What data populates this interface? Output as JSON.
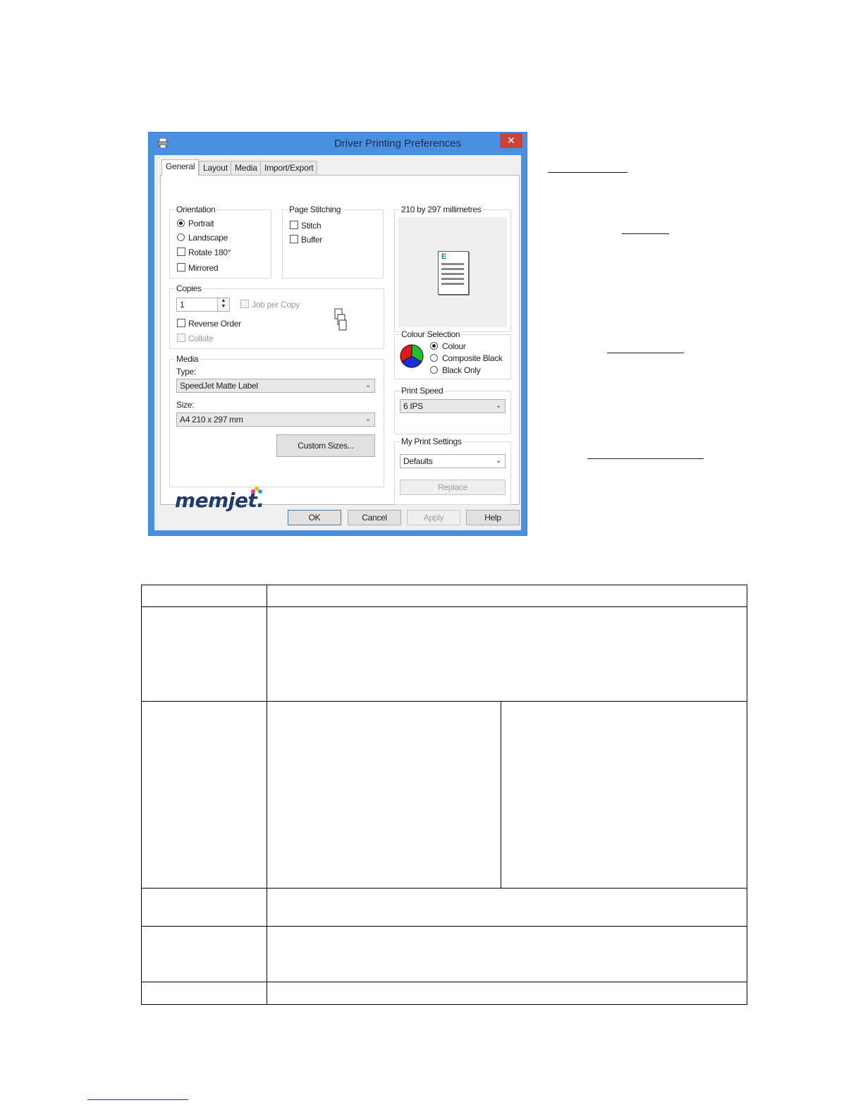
{
  "dialog": {
    "title": "Driver Printing Preferences",
    "close_label": "✕",
    "tabs": [
      "General",
      "Layout",
      "Media",
      "Import/Export"
    ],
    "orientation": {
      "title": "Orientation",
      "portrait": "Portrait",
      "landscape": "Landscape",
      "rotate": "Rotate 180°",
      "mirrored": "Mirrored",
      "selected": "Portrait"
    },
    "page_stitching": {
      "title": "Page Stitching",
      "stitch": "Stitch",
      "buffer": "Buffer"
    },
    "copies": {
      "title": "Copies",
      "value": "1",
      "job_per_copy": "Job per Copy",
      "reverse_order": "Reverse Order",
      "collate": "Collate"
    },
    "media": {
      "title": "Media",
      "type_label": "Type:",
      "type_value": "SpeedJet Matte Label",
      "size_label": "Size:",
      "size_value": "A4 210 x 297 mm",
      "custom_sizes": "Custom Sizes..."
    },
    "preview": {
      "title": "210 by 297 millimetres",
      "page_letter": "E"
    },
    "colour_selection": {
      "title": "Colour Selection",
      "colour": "Colour",
      "composite_black": "Composite Black",
      "black_only": "Black Only",
      "selected": "Colour"
    },
    "print_speed": {
      "title": "Print Speed",
      "value": "6 IPS"
    },
    "my_print_settings": {
      "title": "My Print Settings",
      "value": "Defaults",
      "replace": "Replace"
    },
    "logo": "memjet.",
    "buttons": {
      "ok": "OK",
      "cancel": "Cancel",
      "apply": "Apply",
      "help": "Help"
    }
  },
  "colors": {
    "window_frame": "#4a90e2",
    "close_button": "#c9433a",
    "logo_text": "#1f3b6e"
  }
}
